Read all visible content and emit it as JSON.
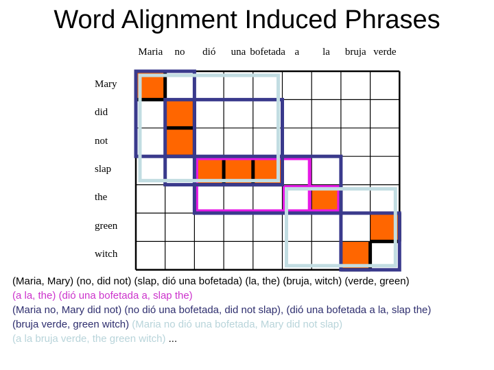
{
  "title": "Word Alignment Induced Phrases",
  "spanish_words": [
    "Maria",
    "no",
    "dió",
    "una",
    "bofetada",
    "a",
    "la",
    "bruja",
    "verde"
  ],
  "english_words": [
    "Mary",
    "did",
    "not",
    "slap",
    "the",
    "green",
    "witch"
  ],
  "colors": {
    "alignment_fill": "#ff6600",
    "grid_line": "#000000",
    "phrase_navy": "#3a3a8c",
    "phrase_light_blue": "#c2dde2",
    "phrase_magenta": "#e619e6",
    "text_black": "#000000",
    "text_navy": "#2e2e6e"
  },
  "alignments": [
    {
      "english": 0,
      "spanish": 0
    },
    {
      "english": 1,
      "spanish": 1
    },
    {
      "english": 2,
      "spanish": 1
    },
    {
      "english": 3,
      "spanish": 2
    },
    {
      "english": 3,
      "spanish": 3
    },
    {
      "english": 3,
      "spanish": 4
    },
    {
      "english": 4,
      "spanish": 6
    },
    {
      "english": 5,
      "spanish": 8
    },
    {
      "english": 6,
      "spanish": 7
    }
  ],
  "phrase_boxes": [
    {
      "color": "navy",
      "english": [
        0,
        2
      ],
      "spanish": [
        0,
        1
      ]
    },
    {
      "color": "navy",
      "english": [
        1,
        3
      ],
      "spanish": [
        1,
        4
      ]
    },
    {
      "color": "navy",
      "english": [
        3,
        4
      ],
      "spanish": [
        2,
        6
      ]
    },
    {
      "color": "navy",
      "english": [
        5,
        6
      ],
      "spanish": [
        7,
        8
      ]
    },
    {
      "color": "light_blue",
      "english": [
        0,
        3
      ],
      "spanish": [
        0,
        4
      ]
    },
    {
      "color": "light_blue",
      "english": [
        4,
        6
      ],
      "spanish": [
        5,
        8
      ]
    },
    {
      "color": "magenta",
      "english": [
        3,
        4
      ],
      "spanish": [
        2,
        5
      ]
    },
    {
      "color": "magenta",
      "english": [
        4,
        4
      ],
      "spanish": [
        5,
        6
      ]
    }
  ],
  "phrase_lines": [
    [
      {
        "text": "(Maria, Mary) (no, did not) (slap, dió una bofetada) (la, the) (bruja, witch) (verde, green)",
        "color": "#000000"
      }
    ],
    [
      {
        "text": "(a la, the) (dió una bofetada a, slap the)",
        "color": "#cc33cc"
      }
    ],
    [
      {
        "text": "(Maria no, Mary did not) (no dió una bofetada, did not slap), (dió una bofetada a la, slap the)",
        "color": "#2e2e6e"
      }
    ],
    [
      {
        "text": "(bruja verde, green witch) ",
        "color": "#2e2e6e"
      },
      {
        "text": "(Maria no dió una bofetada, Mary did not slap)",
        "color": "#b8d4da"
      }
    ],
    [
      {
        "text": "(a la bruja verde, the green witch) ",
        "color": "#b8d4da"
      },
      {
        "text": "...",
        "color": "#000000"
      }
    ]
  ]
}
